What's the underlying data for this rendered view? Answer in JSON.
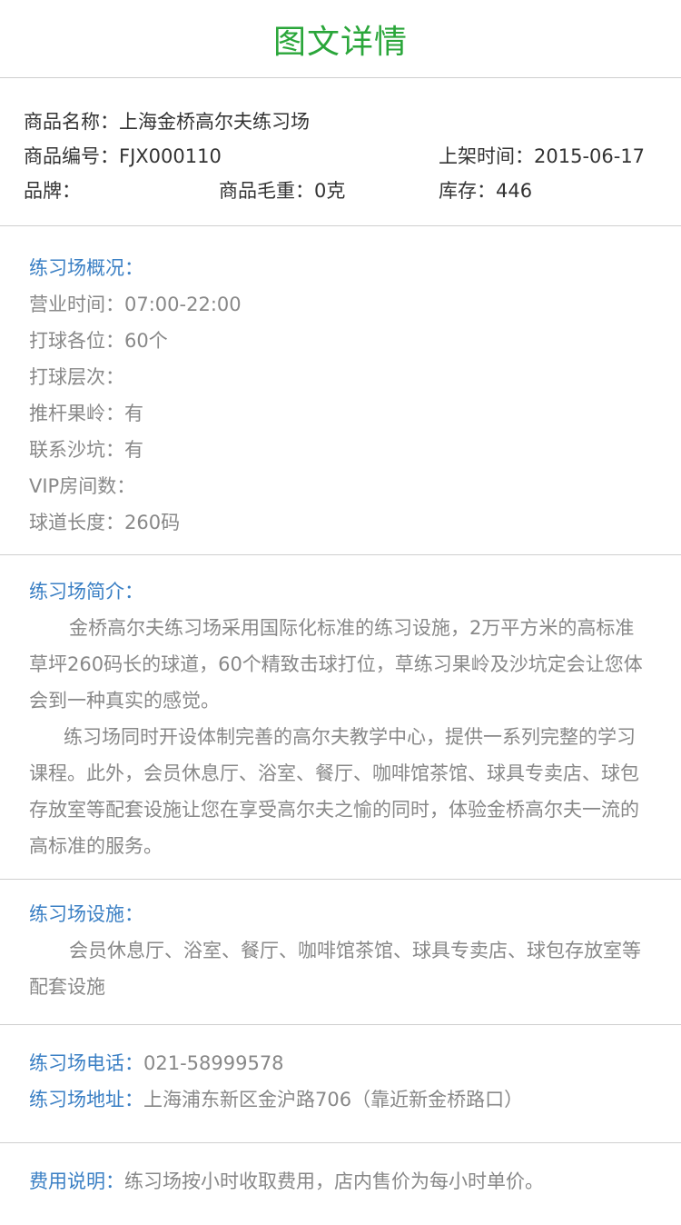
{
  "header": {
    "title": "图文详情"
  },
  "info": {
    "name": "商品名称：上海金桥高尔夫练习场",
    "code": "商品编号：FJX000110",
    "shelf_time": "上架时间：2015-06-17",
    "brand": "品牌：",
    "weight": "商品毛重：0克",
    "stock": "库存：446"
  },
  "overview": {
    "title": "练习场概况：",
    "items": [
      "营业时间：07:00-22:00",
      "打球各位：60个",
      "打球层次：",
      "推杆果岭：有",
      "联系沙坑：有",
      "VIP房间数：",
      "球道长度：260码"
    ]
  },
  "intro": {
    "title": "练习场简介：",
    "para1": "金桥高尔夫练习场采用国际化标准的练习设施，2万平方米的高标准草坪260码长的球道，60个精致击球打位，草练习果岭及沙坑定会让您体会到一种真实的感觉。",
    "para2": "练习场同时开设体制完善的高尔夫教学中心，提供一系列完整的学习课程。此外，会员休息厅、浴室、餐厅、咖啡馆茶馆、球具专卖店、球包存放室等配套设施让您在享受高尔夫之愉的同时，体验金桥高尔夫一流的高标准的服务。"
  },
  "facilities": {
    "title": "练习场设施：",
    "text": "会员休息厅、浴室、餐厅、咖啡馆茶馆、球具专卖店、球包存放室等配套设施"
  },
  "contact": {
    "phone_label": "练习场电话：",
    "phone_value": "021-58999578",
    "address_label": "练习场地址：",
    "address_value": "上海浦东新区金沪路706（靠近新金桥路口）"
  },
  "fee": {
    "label": "费用说明：",
    "value": "练习场按小时收取费用，店内售价为每小时单价。"
  },
  "colors": {
    "title_green": "#2aa63a",
    "label_blue": "#3a7fc4",
    "text_gray": "#888888"
  }
}
